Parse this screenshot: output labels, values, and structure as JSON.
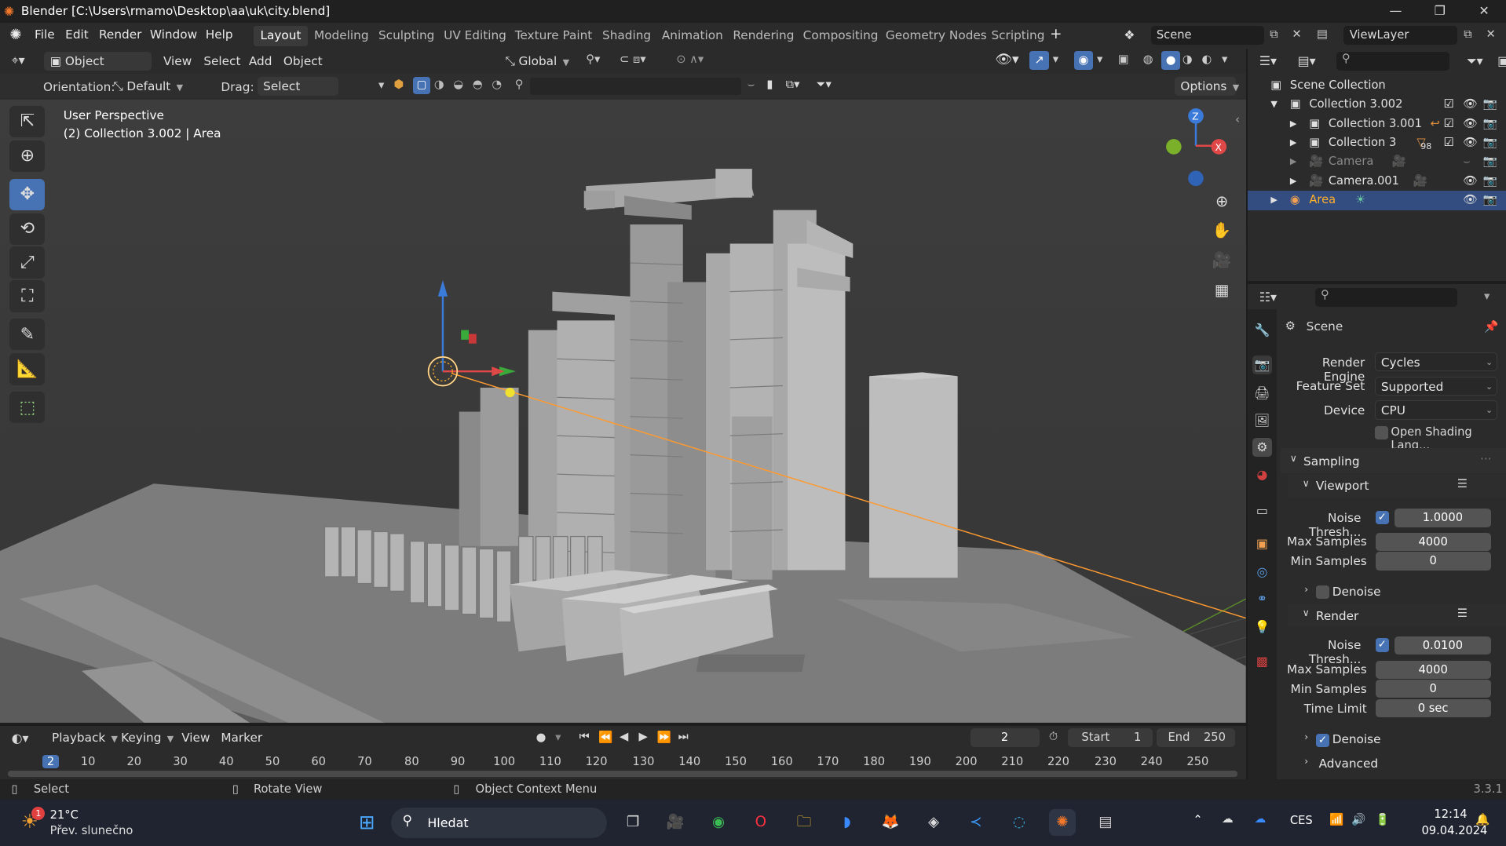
{
  "titlebar": {
    "title": "Blender [C:\\Users\\rmamo\\Desktop\\aa\\uk\\city.blend]"
  },
  "menu": [
    "File",
    "Edit",
    "Render",
    "Window",
    "Help"
  ],
  "workspaces": [
    "Layout",
    "Modeling",
    "Sculpting",
    "UV Editing",
    "Texture Paint",
    "Shading",
    "Animation",
    "Rendering",
    "Compositing",
    "Geometry Nodes",
    "Scripting"
  ],
  "active_workspace": "Layout",
  "scene_field": "Scene",
  "viewlayer_field": "ViewLayer",
  "header": {
    "mode": "Object Mode",
    "view_menu": [
      "View",
      "Select",
      "Add",
      "Object"
    ],
    "transform": "Global",
    "orientation_label": "Orientation:",
    "orientation": "Default",
    "drag_label": "Drag:",
    "drag": "Select Circl",
    "options": "Options"
  },
  "viewport": {
    "perspective": "User Perspective",
    "context": "(2) Collection 3.002 | Area"
  },
  "outliner": {
    "scene_collection": "Scene Collection",
    "items": [
      {
        "label": "Collection 3.002",
        "level": 1
      },
      {
        "label": "Collection 3.001",
        "level": 2
      },
      {
        "label": "Collection 3",
        "level": 2,
        "badge": "98"
      },
      {
        "label": "Camera",
        "level": 2
      },
      {
        "label": "Camera.001",
        "level": 2
      },
      {
        "label": "Area",
        "level": 1
      }
    ]
  },
  "properties": {
    "context": "Scene",
    "render_engine_label": "Render Engine",
    "render_engine": "Cycles",
    "feature_set_label": "Feature Set",
    "feature_set": "Supported",
    "device_label": "Device",
    "device": "CPU",
    "osl": "Open Shading Lang...",
    "sampling": "Sampling",
    "viewport_section": "Viewport",
    "vp_noise_label": "Noise Thresh...",
    "vp_noise": "1.0000",
    "vp_max_label": "Max Samples",
    "vp_max": "4000",
    "vp_min_label": "Min Samples",
    "vp_min": "0",
    "vp_denoise": "Denoise",
    "render_section": "Render",
    "r_noise_label": "Noise Thresh...",
    "r_noise": "0.0100",
    "r_max_label": "Max Samples",
    "r_max": "4000",
    "r_min_label": "Min Samples",
    "r_min": "0",
    "time_limit_label": "Time Limit",
    "time_limit": "0 sec",
    "r_denoise": "Denoise",
    "advanced": "Advanced"
  },
  "timeline": {
    "menus": [
      "Playback",
      "Keying",
      "View",
      "Marker"
    ],
    "current_frame": "2",
    "start_label": "Start",
    "start": "1",
    "end_label": "End",
    "end": "250",
    "ticks": [
      "2",
      "10",
      "20",
      "30",
      "40",
      "50",
      "60",
      "70",
      "80",
      "90",
      "100",
      "110",
      "120",
      "130",
      "140",
      "150",
      "160",
      "170",
      "180",
      "190",
      "200",
      "210",
      "220",
      "230",
      "240",
      "250"
    ]
  },
  "statusbar": {
    "select": "Select",
    "rotate": "Rotate View",
    "context_menu": "Object Context Menu",
    "version": "3.3.1"
  },
  "taskbar": {
    "weather_temp": "21°C",
    "weather_desc": "Přev. slunečno",
    "weather_badge": "1",
    "search": "Hledat",
    "lang": "CES",
    "time": "12:14",
    "date": "09.04.2024"
  },
  "colors": {
    "accent": "#4772b3",
    "active_object": "#ffaf29"
  }
}
